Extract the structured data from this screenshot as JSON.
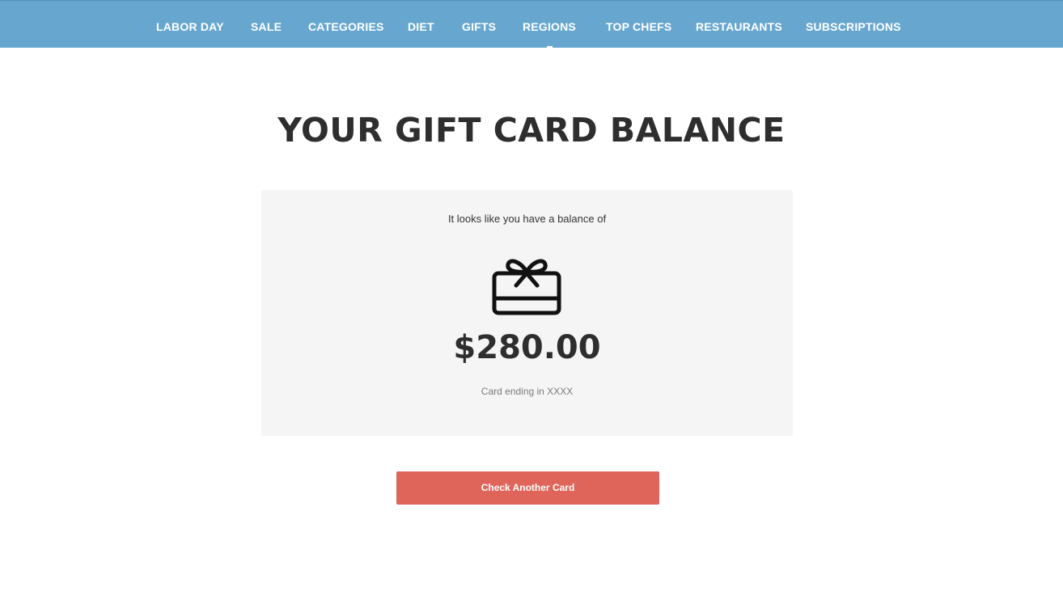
{
  "nav": {
    "items": [
      {
        "label": "LABOR DAY"
      },
      {
        "label": "SALE"
      },
      {
        "label": "CATEGORIES"
      },
      {
        "label": "DIET"
      },
      {
        "label": "GIFTS"
      },
      {
        "label": "REGIONS",
        "active": true
      },
      {
        "label": "TOP CHEFS"
      },
      {
        "label": "RESTAURANTS"
      },
      {
        "label": "SUBSCRIPTIONS"
      }
    ]
  },
  "main": {
    "title": "YOUR GIFT CARD BALANCE",
    "balance_card": {
      "intro": "It looks like you have a balance of",
      "icon": "gift-card-icon",
      "amount": "$280.00",
      "card_ending": "Card ending in XXXX"
    },
    "check_button_label": "Check Another Card"
  },
  "colors": {
    "nav_background": "#67a7cf",
    "button_background": "#df655b",
    "card_background": "#f5f5f5",
    "heading_text": "#2e2e2e"
  }
}
